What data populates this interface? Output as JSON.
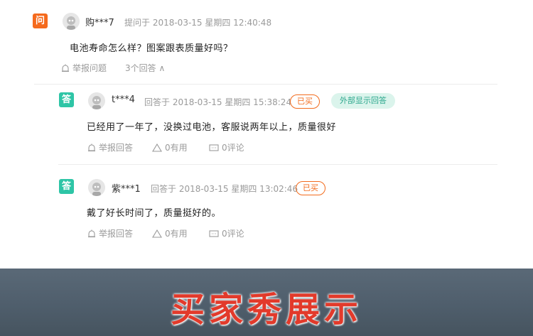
{
  "question": {
    "badge": "问",
    "user": "购***7",
    "meta": "提问于 2018-03-15 星期四 12:40:48",
    "text": "电池寿命怎么样？图案跟表质量好吗？",
    "report_label": "举报问题",
    "answers_toggle": "3个回答 ∧"
  },
  "answers": [
    {
      "badge": "答",
      "user": "t***4",
      "meta": "回答于 2018-03-15 星期四 15:38:24",
      "bought_tag": "已买",
      "external_tag": "外部显示回答",
      "text": "已经用了一年了，没换过电池，客服说两年以上，质量很好",
      "report_label": "举报回答",
      "useful_label": "0有用",
      "comment_label": "0评论"
    },
    {
      "badge": "答",
      "user": "紫***1",
      "meta": "回答于 2018-03-15 星期四 13:02:46",
      "bought_tag": "已买",
      "text": "戴了好长时间了，质量挺好的。",
      "report_label": "举报回答",
      "useful_label": "0有用",
      "comment_label": "0评论"
    }
  ],
  "banner": {
    "title": "买家秀展示"
  },
  "colors": {
    "question_badge": "#f56a1d",
    "answer_badge": "#2ec5a6",
    "bought_tag": "#f26b1d",
    "banner_text": "#e23a2b"
  },
  "icons": [
    "report-alarm-icon",
    "thumb-triangle-icon",
    "comment-box-icon",
    "user-avatar-icon"
  ]
}
